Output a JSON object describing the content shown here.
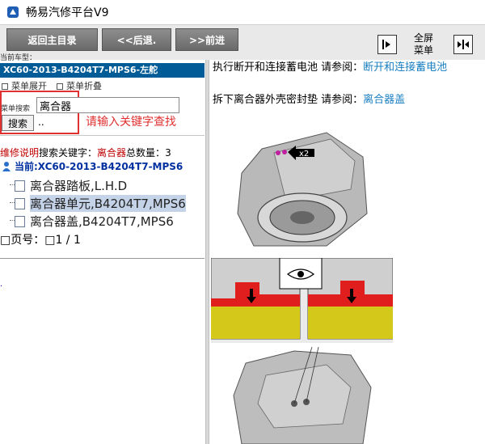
{
  "window": {
    "title": "畅易汽修平台V9"
  },
  "toolbar": {
    "back_main": "返回主目录",
    "back": "<<后退.",
    "forward": ">>前进",
    "fullscreen_label_1": "全屏",
    "fullscreen_label_2": "菜单"
  },
  "left": {
    "current_model_label": "当前车型：",
    "current_model": "XC60-2013-B4204T7-MPS6-左舵",
    "menu_expand": "菜单展开",
    "menu_collapse": "菜单折叠",
    "search_label": "菜单搜索",
    "search_value": "离合器",
    "search_button": "搜索",
    "search_dots": "..",
    "search_hint": "请输入关键字查找",
    "result": {
      "prefix": "维修说明",
      "mid": "搜索关键字：",
      "keyword": "离合器",
      "count_label": "总数量：",
      "count": "3"
    },
    "tree_root": "当前:XC60-2013-B4204T7-MPS6",
    "tree_items": [
      {
        "label": "离合器踏板,L.H.D"
      },
      {
        "label": "离合器单元,B4204T7,MPS6"
      },
      {
        "label": "离合器盖,B4204T7,MPS6"
      }
    ],
    "page_row": "□页号：□1 / 1",
    "tiny_dot": "."
  },
  "right": {
    "steps": [
      {
        "text": "执行断开和连接蓄电池 请参阅：",
        "link": "断开和连接蓄电池"
      },
      {
        "text": "拆下离合器外壳密封垫 请参阅：",
        "link": "离合器盖"
      }
    ],
    "callout": "x2"
  }
}
